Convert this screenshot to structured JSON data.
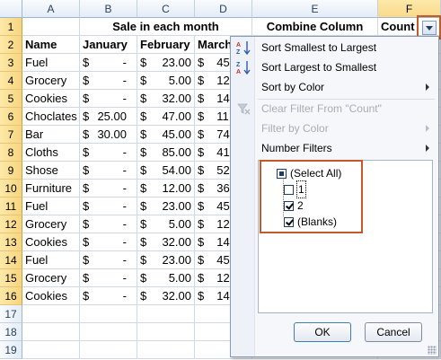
{
  "columns": [
    "A",
    "B",
    "C",
    "D",
    "E",
    "F"
  ],
  "rows": [
    "1",
    "2",
    "3",
    "4",
    "5",
    "6",
    "7",
    "8",
    "9",
    "10",
    "11",
    "12",
    "13",
    "14",
    "15",
    "16",
    "17",
    "18",
    "19"
  ],
  "row1": {
    "merged_title": "Sale in each month",
    "combine_column": "Combine Column",
    "count": "Count"
  },
  "headers": {
    "name": "Name",
    "january": "January",
    "february": "February",
    "march": "March"
  },
  "table": [
    {
      "name": "Fuel",
      "jan_sym": "$",
      "jan": "-",
      "feb_sym": "$",
      "feb": "23.00",
      "mar_sym": "$",
      "mar": "45"
    },
    {
      "name": "Grocery",
      "jan_sym": "$",
      "jan": "-",
      "feb_sym": "$",
      "feb": "5.00",
      "mar_sym": "$",
      "mar": "12"
    },
    {
      "name": "Cookies",
      "jan_sym": "$",
      "jan": "-",
      "feb_sym": "$",
      "feb": "32.00",
      "mar_sym": "$",
      "mar": "14"
    },
    {
      "name": "Choclates",
      "jan_sym": "$",
      "jan": "25.00",
      "feb_sym": "$",
      "feb": "47.00",
      "mar_sym": "$",
      "mar": "11"
    },
    {
      "name": "Bar",
      "jan_sym": "$",
      "jan": "30.00",
      "feb_sym": "$",
      "feb": "45.00",
      "mar_sym": "$",
      "mar": "74"
    },
    {
      "name": "Cloths",
      "jan_sym": "$",
      "jan": "-",
      "feb_sym": "$",
      "feb": "85.00",
      "mar_sym": "$",
      "mar": "41"
    },
    {
      "name": "Shose",
      "jan_sym": "$",
      "jan": "-",
      "feb_sym": "$",
      "feb": "54.00",
      "mar_sym": "$",
      "mar": "52"
    },
    {
      "name": "Furniture",
      "jan_sym": "$",
      "jan": "-",
      "feb_sym": "$",
      "feb": "12.00",
      "mar_sym": "$",
      "mar": "36"
    },
    {
      "name": "Fuel",
      "jan_sym": "$",
      "jan": "-",
      "feb_sym": "$",
      "feb": "23.00",
      "mar_sym": "$",
      "mar": "45"
    },
    {
      "name": "Grocery",
      "jan_sym": "$",
      "jan": "-",
      "feb_sym": "$",
      "feb": "5.00",
      "mar_sym": "$",
      "mar": "12"
    },
    {
      "name": "Cookies",
      "jan_sym": "$",
      "jan": "-",
      "feb_sym": "$",
      "feb": "32.00",
      "mar_sym": "$",
      "mar": "14"
    },
    {
      "name": "Fuel",
      "jan_sym": "$",
      "jan": "-",
      "feb_sym": "$",
      "feb": "23.00",
      "mar_sym": "$",
      "mar": "45"
    },
    {
      "name": "Grocery",
      "jan_sym": "$",
      "jan": "-",
      "feb_sym": "$",
      "feb": "5.00",
      "mar_sym": "$",
      "mar": "12"
    },
    {
      "name": "Cookies",
      "jan_sym": "$",
      "jan": "-",
      "feb_sym": "$",
      "feb": "32.00",
      "mar_sym": "$",
      "mar": "14"
    }
  ],
  "filter_menu": {
    "sort_asc": "Sort Smallest to Largest",
    "sort_desc": "Sort Largest to Smallest",
    "sort_by_color": "Sort by Color",
    "clear_filter": "Clear Filter From \"Count\"",
    "filter_by_color": "Filter by Color",
    "number_filters": "Number Filters",
    "list": [
      {
        "label": "(Select All)",
        "state": "partial"
      },
      {
        "label": "1",
        "state": "unchecked"
      },
      {
        "label": "2",
        "state": "checked"
      },
      {
        "label": "(Blanks)",
        "state": "checked"
      }
    ],
    "ok": "OK",
    "cancel": "Cancel"
  },
  "icons": {
    "sort_asc": "sort-ascending-icon",
    "sort_desc": "sort-descending-icon",
    "clear_filter": "clear-filter-icon",
    "dropdown": "chevron-down-icon"
  },
  "colors": {
    "highlight_border": "#c55a28",
    "active_header": "#f8d57e"
  }
}
